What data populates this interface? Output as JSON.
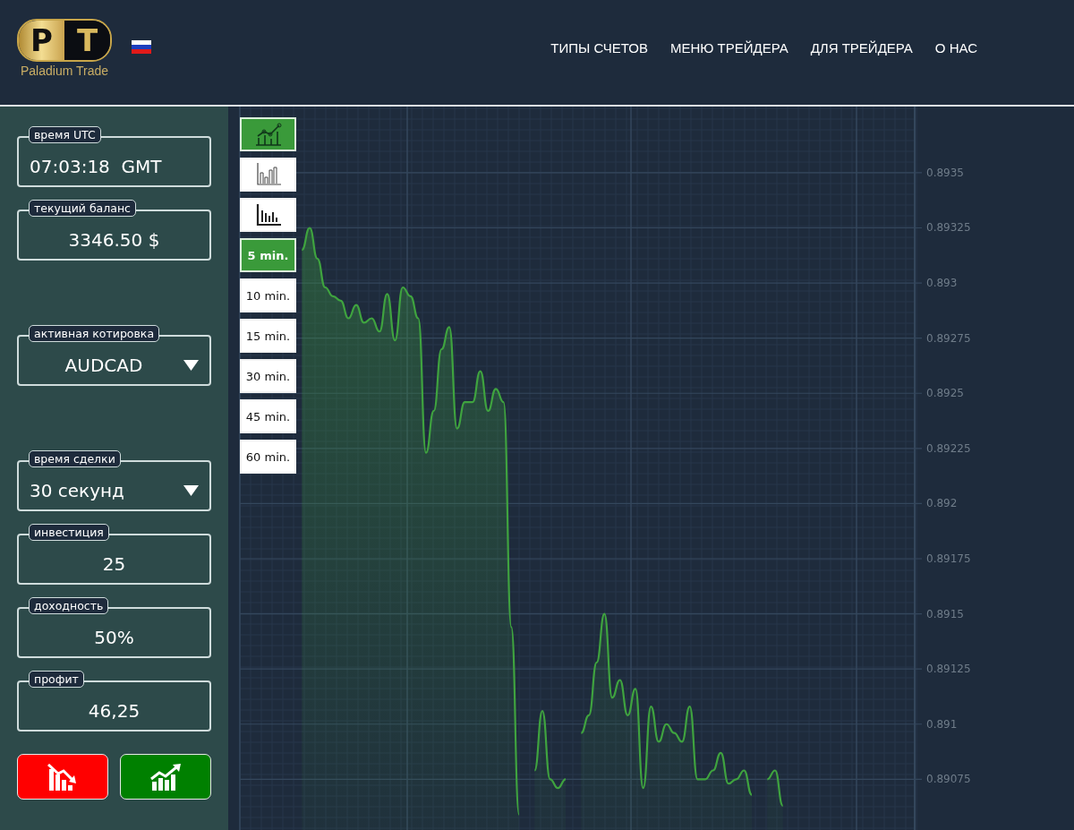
{
  "header": {
    "logo": {
      "letters": [
        "P",
        "T"
      ],
      "name": "Paladium Trade"
    },
    "nav": [
      {
        "label": "ТИПЫ СЧЕТОВ"
      },
      {
        "label": "МЕНЮ ТРЕЙДЕРА"
      },
      {
        "label": "ДЛЯ ТРЕЙДЕРА"
      },
      {
        "label": "О НАС"
      }
    ]
  },
  "sidebar": {
    "sections": [
      {
        "fields": [
          {
            "kind": "display",
            "label": "время UTC",
            "value": "07:03:18  GMT",
            "centered": false
          },
          {
            "kind": "display",
            "label": "текущий баланс",
            "value": "3346.50 $",
            "centered": true
          }
        ]
      },
      {
        "fields": [
          {
            "kind": "select",
            "label": "активная котировка",
            "value": "AUDCAD",
            "centered": true
          }
        ]
      },
      {
        "fields": [
          {
            "kind": "select",
            "label": "время сделки",
            "value": "30 секунд",
            "centered": false
          },
          {
            "kind": "input",
            "label": "инвестиция",
            "value": "25",
            "centered": true
          },
          {
            "kind": "display",
            "label": "доходность",
            "value": "50%",
            "centered": true
          },
          {
            "kind": "display",
            "label": "профит",
            "value": "46,25",
            "centered": true
          }
        ]
      }
    ],
    "trade_buttons": [
      {
        "kind": "down"
      },
      {
        "kind": "up"
      }
    ]
  },
  "chart": {
    "chart_types": [
      {
        "kind": "line",
        "selected": true
      },
      {
        "kind": "columns",
        "selected": false
      },
      {
        "kind": "bars",
        "selected": false
      }
    ],
    "timeframes": [
      {
        "label": "5 min.",
        "selected": true
      },
      {
        "label": "10 min.",
        "selected": false
      },
      {
        "label": "15 min.",
        "selected": false
      },
      {
        "label": "30 min.",
        "selected": false
      },
      {
        "label": "45 min.",
        "selected": false
      },
      {
        "label": "60 min.",
        "selected": false
      }
    ],
    "chart_data": {
      "type": "area",
      "grid": true,
      "ylim": [
        0.89052,
        0.8938
      ],
      "yticks": [
        {
          "value": 0.8935,
          "label": "0.8935"
        },
        {
          "value": 0.89325,
          "label": "0.89325"
        },
        {
          "value": 0.893,
          "label": "0.893"
        },
        {
          "value": 0.89275,
          "label": "0.89275"
        },
        {
          "value": 0.8925,
          "label": "0.8925"
        },
        {
          "value": 0.89225,
          "label": "0.89225"
        },
        {
          "value": 0.892,
          "label": "0.892"
        },
        {
          "value": 0.89175,
          "label": "0.89175"
        },
        {
          "value": 0.8915,
          "label": "0.8915"
        },
        {
          "value": 0.89125,
          "label": "0.89125"
        },
        {
          "value": 0.891,
          "label": "0.891"
        },
        {
          "value": 0.89075,
          "label": "0.89075"
        }
      ],
      "series": [
        {
          "color": "#3fa33f",
          "values": [
            null,
            null,
            null,
            null,
            null,
            null,
            null,
            null,
            0.89315,
            0.89325,
            0.89311,
            0.89298,
            0.89294,
            0.89292,
            0.89284,
            0.8929,
            0.89282,
            0.89284,
            0.89278,
            0.89295,
            0.89274,
            0.89298,
            0.89294,
            0.89284,
            0.89223,
            0.89242,
            0.8927,
            0.8928,
            0.89234,
            0.89246,
            0.89246,
            0.8926,
            0.89242,
            0.89252,
            0.89246,
            0.89144,
            0.89059,
            null,
            0.89079,
            0.89106,
            0.89075,
            0.89071,
            0.89075,
            null,
            0.89096,
            0.89104,
            0.89128,
            0.8915,
            0.89112,
            0.8912,
            0.89104,
            0.89116,
            0.89071,
            0.89108,
            0.89092,
            0.891,
            0.89096,
            0.89092,
            0.89108,
            0.89075,
            0.89075,
            0.89079,
            0.89087,
            0.89073,
            0.89075,
            0.89079,
            0.89068,
            null,
            0.89075,
            0.89079,
            0.89063,
            null,
            null,
            null,
            null,
            null,
            null,
            null,
            null,
            null,
            null,
            null,
            null,
            null,
            null,
            null,
            null,
            null
          ]
        }
      ]
    }
  }
}
